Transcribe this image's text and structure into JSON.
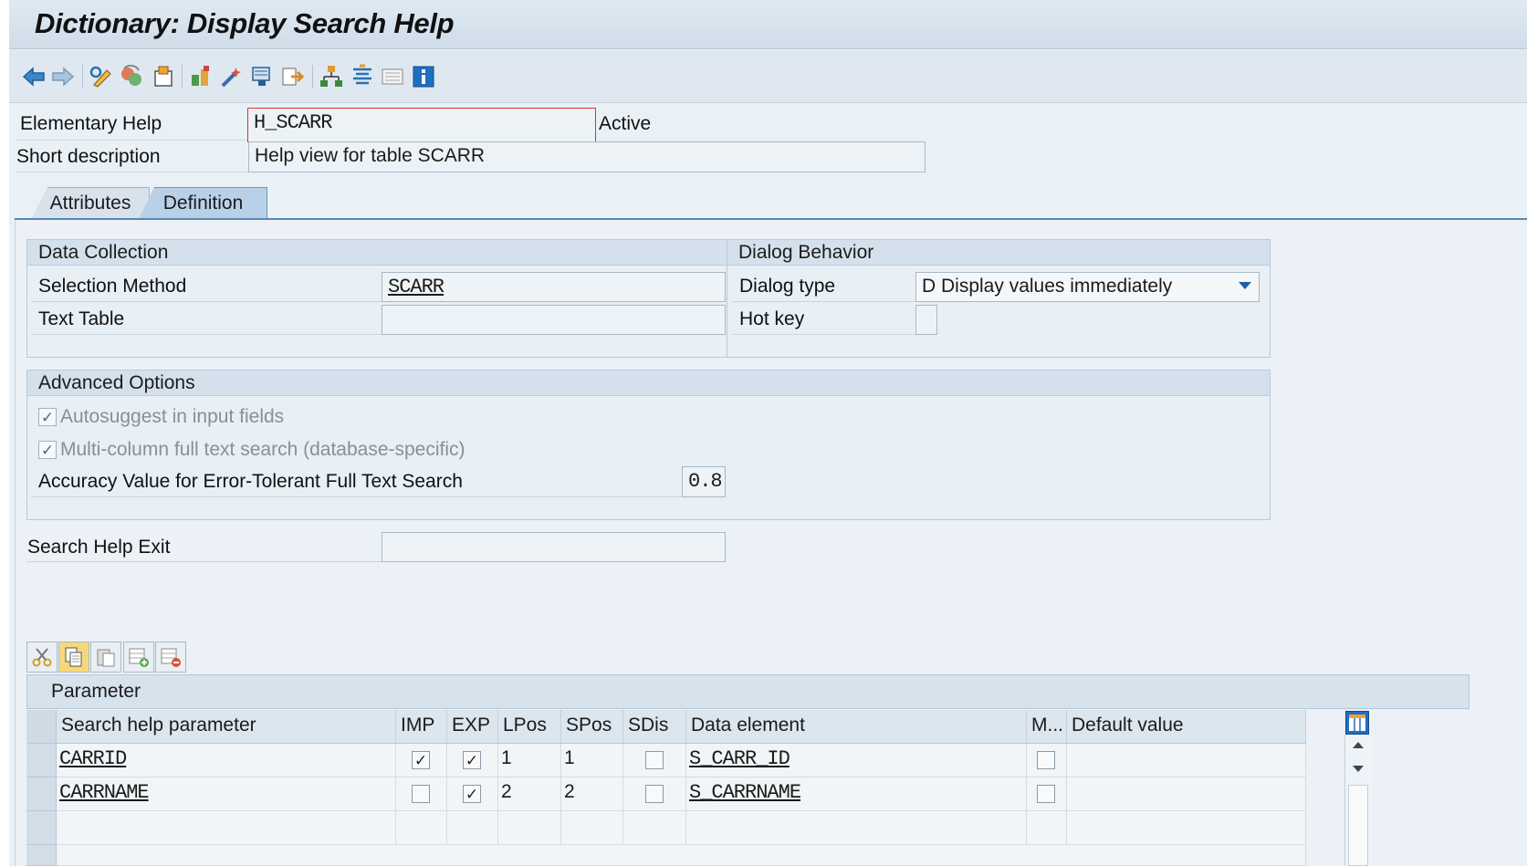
{
  "window": {
    "title": "Dictionary: Display Search Help"
  },
  "toolbar": {
    "buttons": [
      {
        "icon": "back-arrow-icon"
      },
      {
        "icon": "forward-arrow-icon"
      },
      {
        "icon": "display-change-icon"
      },
      {
        "icon": "active-inactive-icon"
      },
      {
        "icon": "other-object-icon"
      },
      {
        "icon": "check-icon"
      },
      {
        "icon": "activate-icon"
      },
      {
        "icon": "where-used-icon"
      },
      {
        "icon": "test-icon"
      },
      {
        "icon": "hierarchy-icon"
      },
      {
        "icon": "display-object-list-icon"
      },
      {
        "icon": "documentation-icon"
      },
      {
        "icon": "info-icon"
      }
    ]
  },
  "header": {
    "elementary_help_label": "Elementary Help",
    "elementary_help_value": "H_SCARR",
    "status": "Active",
    "short_description_label": "Short description",
    "short_description_value": "Help view for table SCARR"
  },
  "tabs": [
    {
      "label": "Attributes",
      "active": false
    },
    {
      "label": "Definition",
      "active": true
    }
  ],
  "data_collection": {
    "title": "Data Collection",
    "selection_method_label": "Selection Method",
    "selection_method_value": "SCARR",
    "text_table_label": "Text Table",
    "text_table_value": ""
  },
  "dialog_behavior": {
    "title": "Dialog Behavior",
    "dialog_type_label": "Dialog type",
    "dialog_type_value": "D Display values immediately",
    "hot_key_label": "Hot key",
    "hot_key_value": ""
  },
  "advanced_options": {
    "title": "Advanced Options",
    "autosuggest_label": "Autosuggest in input fields",
    "autosuggest_checked": true,
    "multicolumn_label": "Multi-column full text search (database-specific)",
    "multicolumn_checked": true,
    "accuracy_label": "Accuracy Value for Error-Tolerant Full Text Search",
    "accuracy_value": "0.8"
  },
  "search_help_exit": {
    "label": "Search Help Exit",
    "value": ""
  },
  "table_toolbar": {
    "buttons": [
      {
        "icon": "cut-icon"
      },
      {
        "icon": "copy-icon"
      },
      {
        "icon": "paste-icon"
      },
      {
        "icon": "insert-row-icon"
      },
      {
        "icon": "delete-row-icon"
      }
    ]
  },
  "parameter_table": {
    "title": "Parameter",
    "columns": [
      "Search help parameter",
      "IMP",
      "EXP",
      "LPos",
      "SPos",
      "SDis",
      "Data element",
      "M...",
      "Default value"
    ],
    "rows": [
      {
        "param": "CARRID",
        "imp": true,
        "exp": true,
        "lpos": "1",
        "spos": "1",
        "sdis": false,
        "data_element": "S_CARR_ID",
        "m": false,
        "default": ""
      },
      {
        "param": "CARRNAME",
        "imp": false,
        "exp": true,
        "lpos": "2",
        "spos": "2",
        "sdis": false,
        "data_element": "S_CARRNAME",
        "m": false,
        "default": ""
      }
    ]
  },
  "colors": {
    "accent": "#0a6ed1",
    "tab_active": "#b9d1e8",
    "panel": "#ebf1f6"
  }
}
